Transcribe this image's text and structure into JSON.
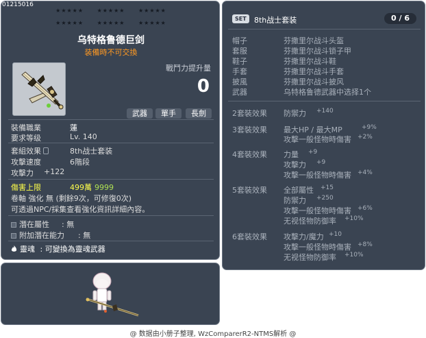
{
  "item": {
    "id": "01215016",
    "stars_row1": [
      "★★★★★",
      "★★★★★",
      "★★★★★"
    ],
    "stars_row2": [
      "★★★★★",
      "★★★★★",
      "★★★★★"
    ],
    "name": "乌特格鲁德巨剑",
    "trade_note": "装備時不可交換",
    "icon": "greatsword-icon",
    "power_label": "戰鬥力提升量",
    "power_value": "0",
    "tags": [
      "武器",
      "單手",
      "長劍"
    ],
    "job_label": "裝備職業",
    "job_value": "蓮",
    "level_label": "要求等级",
    "level_value": "Lv. 140",
    "set_effect_label": "套組效果",
    "set_effect_value": "8th战士套装",
    "attack_speed_label": "攻擊速度",
    "attack_speed_value": "6階段",
    "attack_label": "攻擊力",
    "attack_value": "+122",
    "damage_cap_label": "傷害上限",
    "damage_cap_value": "499萬",
    "damage_cap_value2": "9999",
    "scroll_text": "卷軸 強化 無 (剩餘9次，可修復0次)",
    "hint_text": "可透過NPC/採集查看強化資訊詳細內容。",
    "potential_label": "潛在屬性",
    "potential_value": ": 無",
    "bonus_potential_label": "附加潛在能力",
    "bonus_potential_value": ": 無",
    "soul_label": "靈魂",
    "soul_value": ": 可變換為靈魂武器",
    "colors": {
      "trade_note": "#ff9922",
      "damage_cap": "#fdfd4a",
      "panel_bg": "#3a4452"
    }
  },
  "set": {
    "badge": "SET",
    "title": "8th战士套装",
    "count": "0 / 6",
    "items": [
      {
        "slot": "帽子",
        "name": "芬撒里尔战斗头盔"
      },
      {
        "slot": "套服",
        "name": "芬撒里尔战斗锁子甲"
      },
      {
        "slot": "鞋子",
        "name": "芬撒里尔战斗鞋"
      },
      {
        "slot": "手套",
        "name": "芬撒里尔战斗手套"
      },
      {
        "slot": "披風",
        "name": "芬撒里尔战斗披风"
      },
      {
        "slot": "武器",
        "name": "乌特格鲁德武器中选择1个"
      }
    ],
    "effects": {
      "e2": {
        "title": "2套裝效果",
        "lines": [
          [
            "防禦力",
            "+140"
          ]
        ]
      },
      "e3": {
        "title": "3套裝效果",
        "lines": [
          [
            "最大HP / 最大MP",
            "+9%"
          ],
          [
            "攻擊一般怪物時傷害",
            "+2%"
          ]
        ]
      },
      "e4": {
        "title": "4套裝效果",
        "lines": [
          [
            "力量",
            "+9"
          ],
          [
            "攻擊力",
            "+9"
          ],
          [
            "攻擊一般怪物時傷害",
            "+4%"
          ]
        ]
      },
      "e5": {
        "title": "5套裝效果",
        "lines": [
          [
            "全部屬性",
            "+15"
          ],
          [
            "防禦力",
            "+250"
          ],
          [
            "攻擊一般怪物時傷害",
            "+6%"
          ],
          [
            "无视怪物防御率",
            "+10%"
          ]
        ]
      },
      "e6": {
        "title": "6套裝效果",
        "lines": [
          [
            "攻擊力/魔力",
            "+10"
          ],
          [
            "攻擊一般怪物時傷害",
            "+8%"
          ],
          [
            "无视怪物防御率",
            "+10%"
          ]
        ]
      }
    }
  },
  "preview": {
    "character": "character-preview",
    "weapon": "greatsword-icon"
  },
  "footer": "@ 数据由小册子整理, WzComparerR2-NTMS解析 @"
}
